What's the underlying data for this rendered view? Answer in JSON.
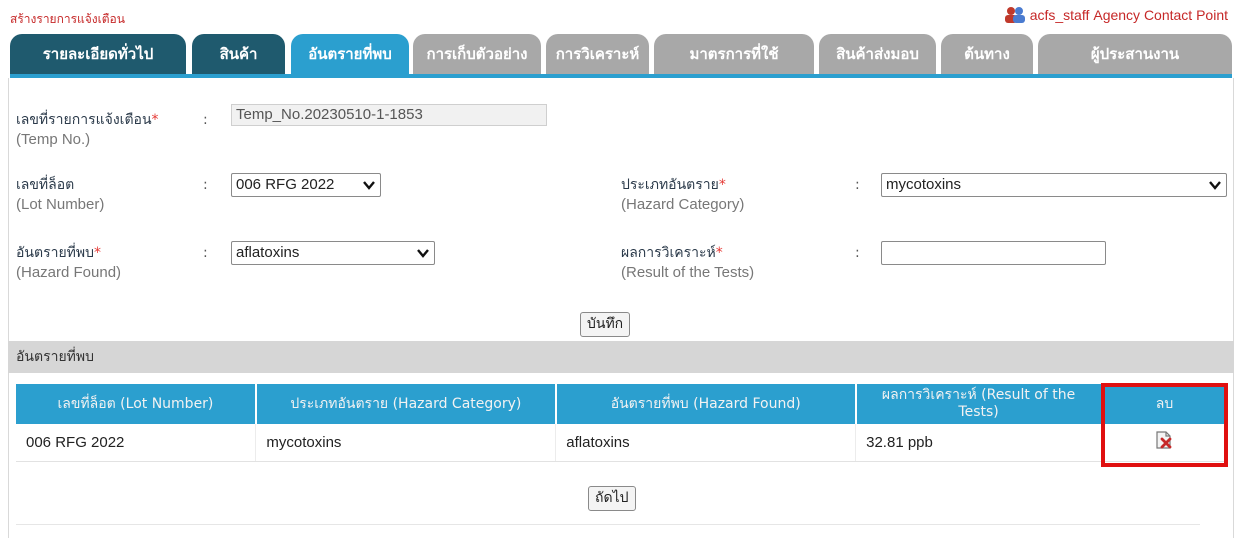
{
  "header": {
    "title": "สร้างรายการแจ้งเตือน",
    "user_name": "acfs_staff",
    "user_role": "Agency Contact Point",
    "user_icon": "users-icon"
  },
  "tabs": [
    {
      "label": "รายละเอียดทั่วไป",
      "state": "done"
    },
    {
      "label": "สินค้า",
      "state": "done"
    },
    {
      "label": "อันตรายที่พบ",
      "state": "active"
    },
    {
      "label": "การเก็บตัวอย่าง",
      "state": "todo"
    },
    {
      "label": "การวิเคราะห์",
      "state": "todo"
    },
    {
      "label": "มาตรการที่ใช้",
      "state": "todo"
    },
    {
      "label": "สินค้าส่งมอบ",
      "state": "todo"
    },
    {
      "label": "ต้นทาง",
      "state": "todo"
    },
    {
      "label": "ผู้ประสานงาน",
      "state": "todo"
    }
  ],
  "form": {
    "temp_no": {
      "label": "เลขที่รายการแจ้งเตือน",
      "sub": "(Temp No.)",
      "required": "*",
      "value": "Temp_No.20230510-1-1853"
    },
    "lot_number": {
      "label": "เลขที่ล็อต",
      "sub": "(Lot Number)",
      "value": "006 RFG 2022"
    },
    "hazard_category": {
      "label": "ประเภทอันตราย",
      "sub": "(Hazard Category)",
      "required": "*",
      "value": "mycotoxins"
    },
    "hazard_found": {
      "label": "อันตรายที่พบ",
      "sub": "(Hazard Found)",
      "required": "*",
      "value": "aflatoxins"
    },
    "result": {
      "label": "ผลการวิเคราะห์",
      "sub": "(Result of the Tests)",
      "required": "*",
      "value": ""
    },
    "colon": ":",
    "save_label": "บันทึก"
  },
  "section": {
    "title": "อันตรายที่พบ"
  },
  "table": {
    "headers": [
      "เลขที่ล็อต (Lot Number)",
      "ประเภทอันตราย (Hazard Category)",
      "อันตรายที่พบ (Hazard Found)",
      "ผลการวิเคราะห์ (Result of the Tests)",
      "ลบ"
    ],
    "rows": [
      {
        "lot": "006 RFG 2022",
        "category": "mycotoxins",
        "hazard": "aflatoxins",
        "result": "32.81 ppb",
        "delete_icon": "delete-icon"
      }
    ]
  },
  "next_label": "ถัดไป",
  "colors": {
    "tab_done": "#1f5a6e",
    "tab_active": "#2b9fcf",
    "tab_todo": "#a8a8a8",
    "required": "#e53935",
    "highlight": "#e01010"
  }
}
